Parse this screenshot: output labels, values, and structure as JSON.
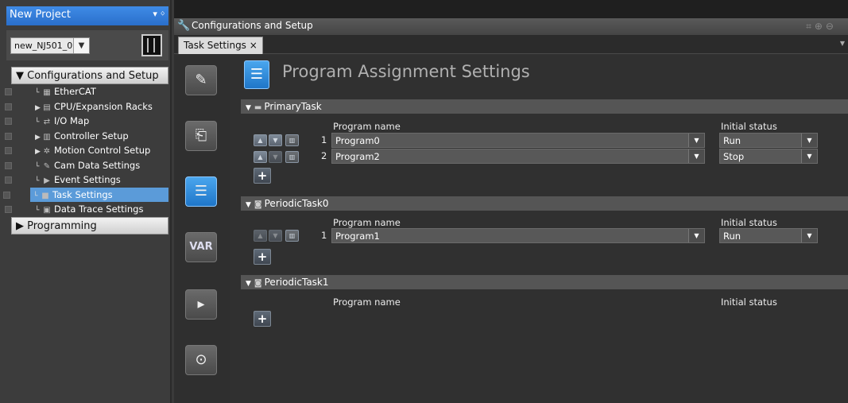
{
  "project_panel": {
    "title": "New Project",
    "pin_glyph": "▾ ᛜ",
    "device_select": "new_NJ501_0",
    "config_section": "▼ Configurations and Setup",
    "programming_section": "▶ Programming",
    "tree": [
      {
        "label": "EtherCAT",
        "icon": "ethercat-icon",
        "glyph": "▦",
        "expander": ""
      },
      {
        "label": "CPU/Expansion Racks",
        "icon": "rack-icon",
        "glyph": "▤",
        "expander": "▶"
      },
      {
        "label": "I/O Map",
        "icon": "io-map-icon",
        "glyph": "⇄",
        "expander": ""
      },
      {
        "label": "Controller Setup",
        "icon": "controller-setup-icon",
        "glyph": "▥",
        "expander": "▶"
      },
      {
        "label": "Motion Control Setup",
        "icon": "motion-control-icon",
        "glyph": "✲",
        "expander": "▶"
      },
      {
        "label": "Cam Data Settings",
        "icon": "cam-data-icon",
        "glyph": "✎",
        "expander": ""
      },
      {
        "label": "Event Settings",
        "icon": "event-settings-icon",
        "glyph": "▶",
        "expander": ""
      },
      {
        "label": "Task Settings",
        "icon": "task-settings-icon",
        "glyph": "■",
        "expander": ""
      },
      {
        "label": "Data Trace Settings",
        "icon": "data-trace-icon",
        "glyph": "▣",
        "expander": ""
      }
    ]
  },
  "editor": {
    "window_title": "Configurations and Setup",
    "tab_label": "Task Settings ×",
    "page_title": "Program Assignment Settings",
    "program_name_header": "Program name",
    "initial_status_header": "Initial status",
    "add_glyph": "+",
    "tasks": [
      {
        "name": "PrimaryTask",
        "rows": [
          {
            "num": "1",
            "program": "Program0",
            "status": "Run"
          },
          {
            "num": "2",
            "program": "Program2",
            "status": "Stop"
          }
        ]
      },
      {
        "name": "PeriodicTask0",
        "rows": [
          {
            "num": "1",
            "program": "Program1",
            "status": "Run"
          }
        ]
      },
      {
        "name": "PeriodicTask1",
        "rows": []
      }
    ]
  },
  "toolbar_icons": [
    "pencil-icon",
    "build-icon",
    "program-assignment-icon",
    "var-icon",
    "watch-icon",
    "trace-icon"
  ],
  "var_label": "VAR",
  "colors": {
    "accent": "#2a7bd8",
    "selection": "#5b9bd9",
    "background": "#303030"
  }
}
